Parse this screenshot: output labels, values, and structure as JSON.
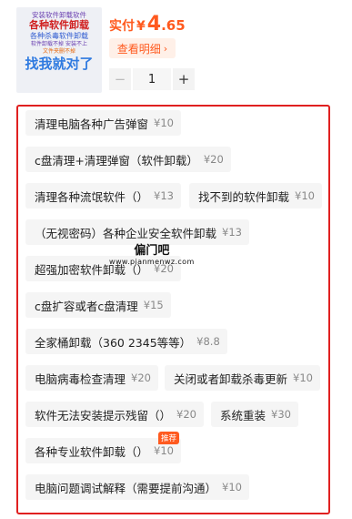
{
  "product": {
    "thumbnail_lines": [
      "安装软件卸载软件",
      "各种软件卸载",
      "各种杀毒软件卸载",
      "软件卸载不掉 安装不上",
      "文件夹删不掉",
      "找我就对了"
    ]
  },
  "price": {
    "label": "实付",
    "currency": "¥",
    "integer": "4",
    "decimal": ".65"
  },
  "detail_button": {
    "label": "查看明细",
    "chevron": "›"
  },
  "quantity": {
    "minus": "−",
    "value": "1",
    "plus": "+"
  },
  "options": [
    {
      "name": "清理电脑各种广告弹窗",
      "price": "¥10"
    },
    {
      "name": "c盘清理+清理弹窗（软件卸载）",
      "price": "¥20"
    },
    {
      "name": "清理各种流氓软件（）",
      "price": "¥13"
    },
    {
      "name": "找不到的软件卸载",
      "price": "¥10"
    },
    {
      "name": "（无视密码）各种企业安全软件卸载",
      "price": "¥13"
    },
    {
      "name": "超强加密软件卸载（）",
      "price": "¥20"
    },
    {
      "name": "c盘扩容或者c盘清理",
      "price": "¥15"
    },
    {
      "name": "全家桶卸载（360  2345等等）",
      "price": "¥8.8"
    },
    {
      "name": "电脑病毒检查清理",
      "price": "¥20"
    },
    {
      "name": "关闭或者卸载杀毒更新",
      "price": "¥10"
    },
    {
      "name": "软件无法安装提示残留（）",
      "price": "¥20"
    },
    {
      "name": "系统重装",
      "price": "¥30"
    },
    {
      "name": "各种专业软件卸载（）",
      "price": "¥10",
      "badge": "推荐"
    },
    {
      "name": "电脑问题调试解释（需要提前沟通）",
      "price": "¥10"
    }
  ],
  "watermark": {
    "line1": "偏门吧",
    "line2": "www.pianmenwz.com"
  },
  "colors": {
    "accent": "#ff5a1f",
    "highlight_border": "#e02020",
    "chip_bg": "#f5f5f5"
  }
}
